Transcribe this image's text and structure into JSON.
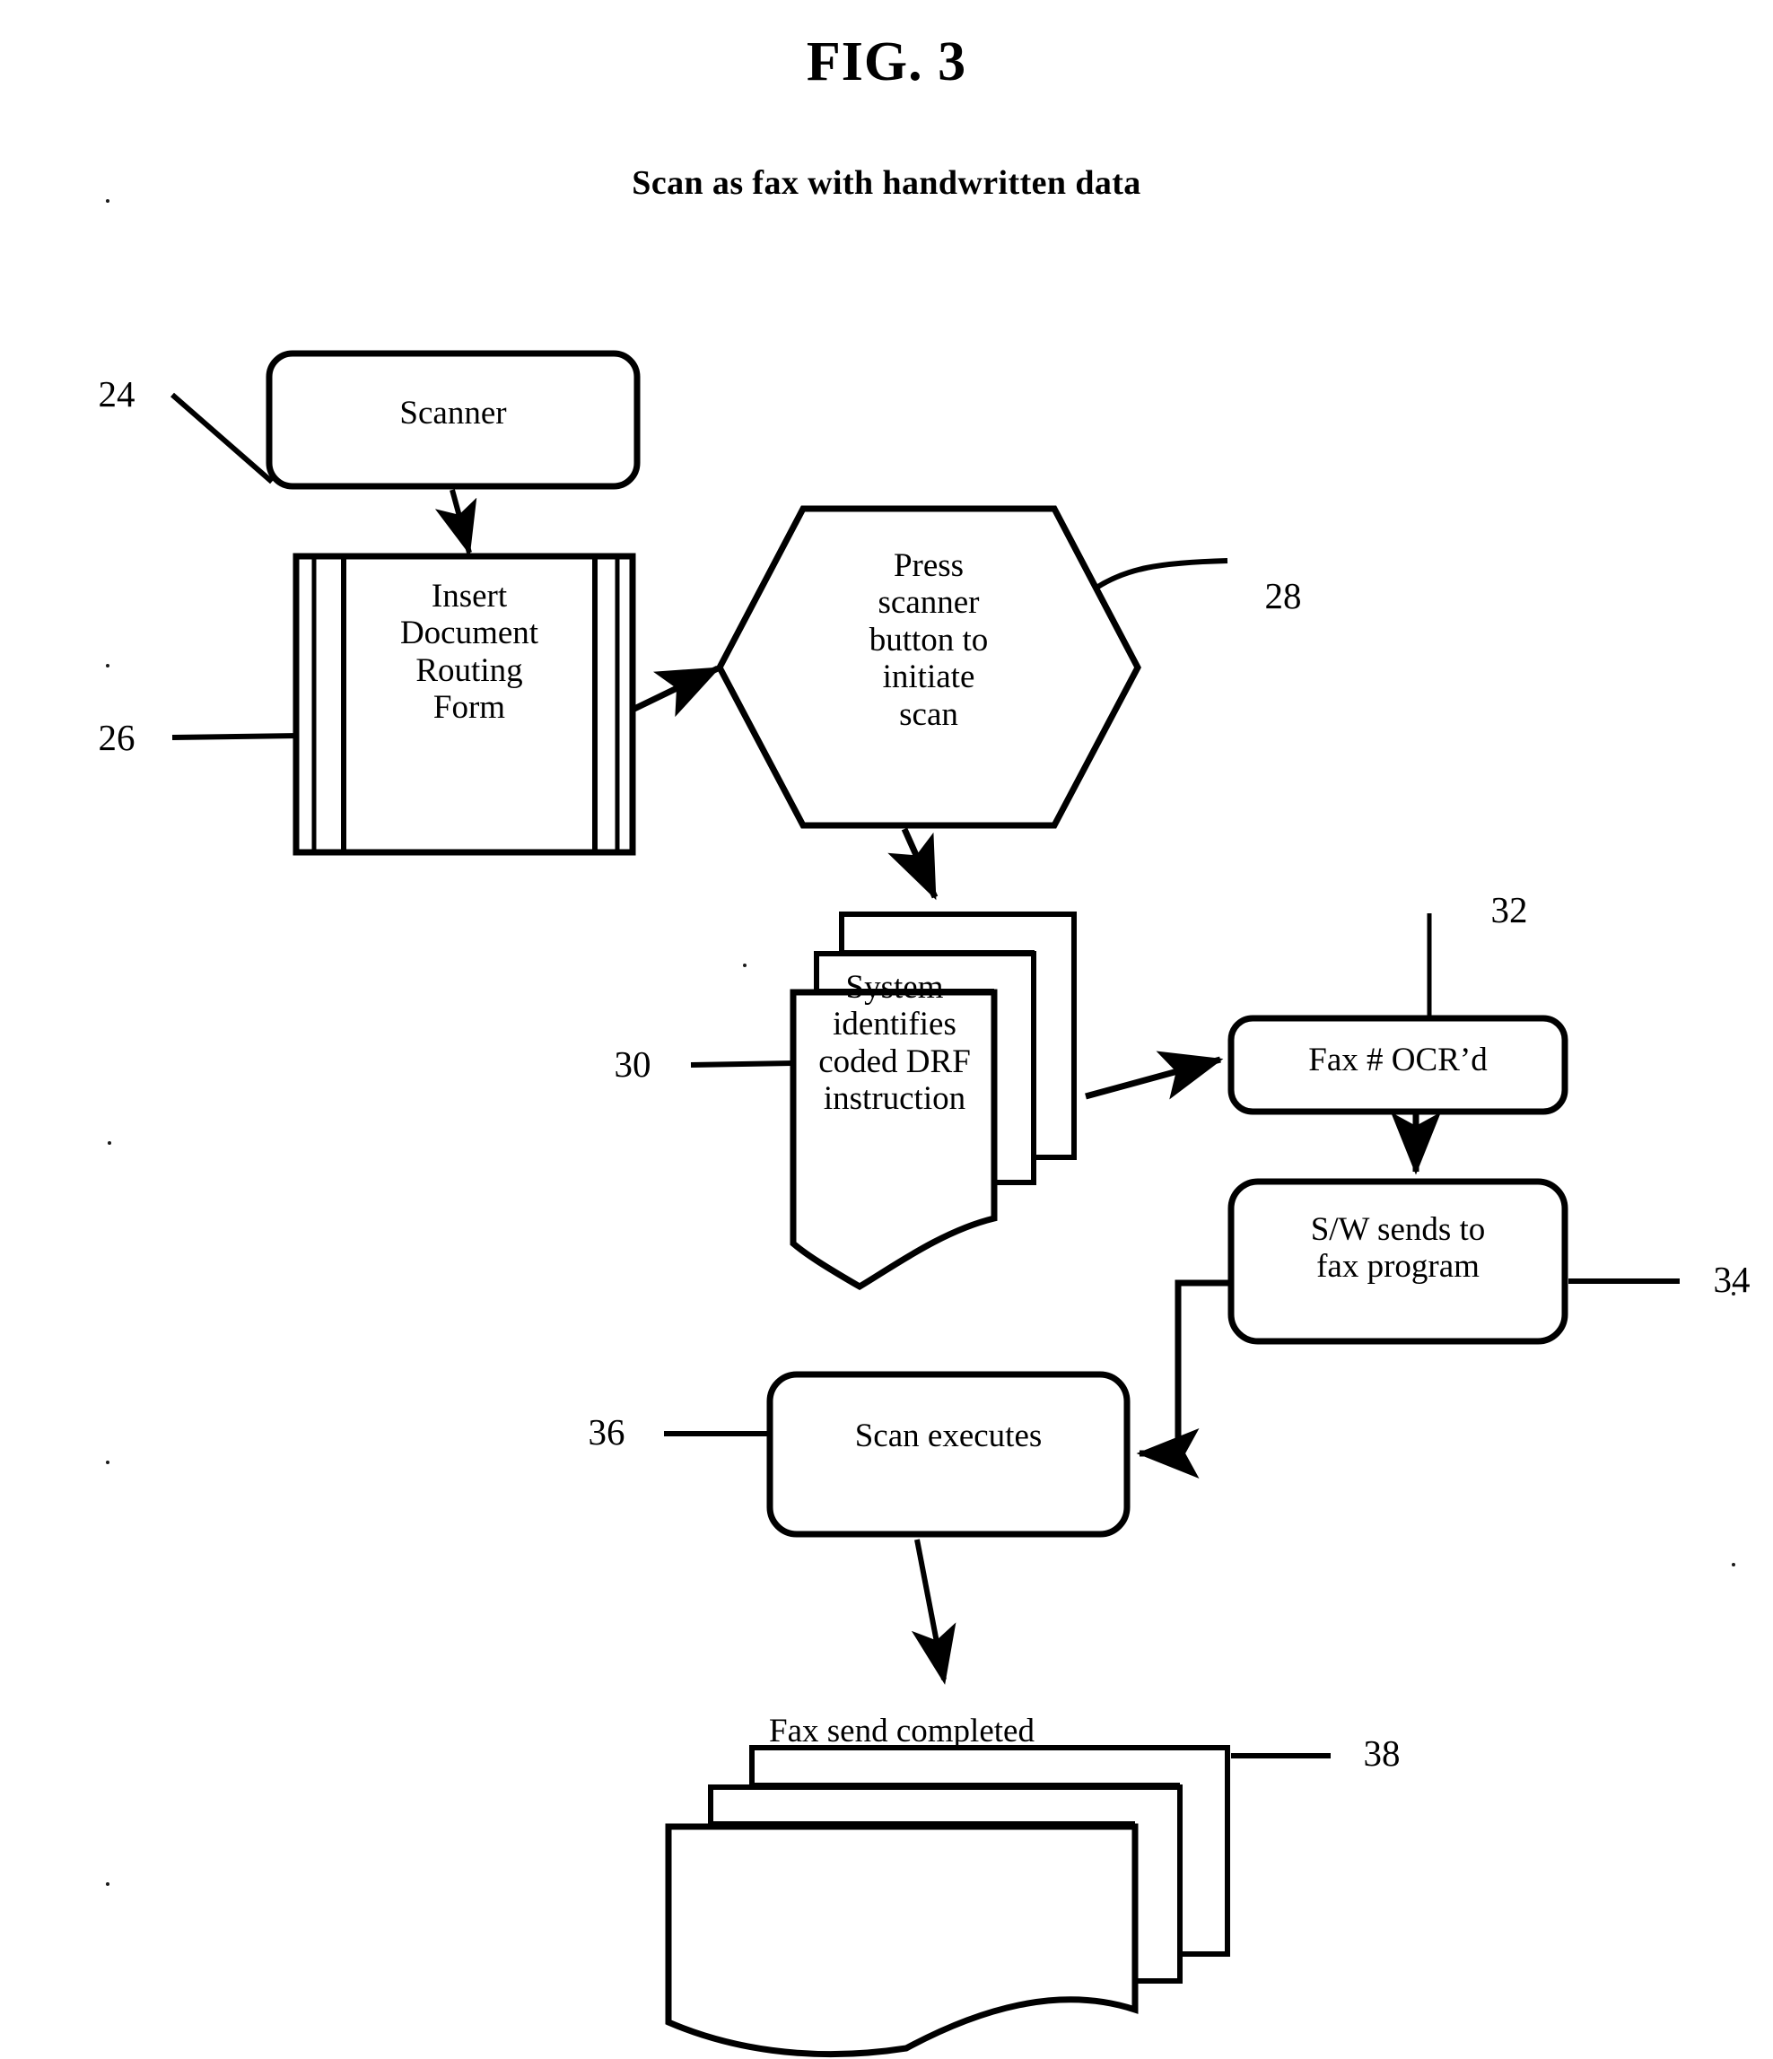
{
  "figure": {
    "title": "FIG. 3",
    "subtitle": "Scan as fax with handwritten data"
  },
  "nodes": {
    "scanner": {
      "label": "Scanner",
      "ref": "24",
      "shape": "rounded-rectangle"
    },
    "insert_drf": {
      "label": "Insert\nDocument\nRouting\nForm",
      "ref": "26",
      "shape": "document-with-margins"
    },
    "press_button": {
      "label": "Press\nscanner\nbutton to\ninitiate\nscan",
      "ref": "28",
      "shape": "hexagon"
    },
    "system_identifies": {
      "label": "System\nidentifies\ncoded DRF\ninstruction",
      "ref": "30",
      "shape": "multi-document"
    },
    "fax_ocr": {
      "label": "Fax # OCR’d",
      "ref": "32",
      "shape": "rounded-rectangle"
    },
    "sw_sends": {
      "label": "S/W sends to\nfax program",
      "ref": "34",
      "shape": "rounded-rectangle"
    },
    "scan_executes": {
      "label": "Scan executes",
      "ref": "36",
      "shape": "rounded-rectangle"
    },
    "fax_completed": {
      "label": "Fax send completed",
      "ref": "38",
      "shape": "multi-document"
    }
  },
  "reference_numerals": [
    {
      "id": "24",
      "value": "24",
      "target": "scanner"
    },
    {
      "id": "26",
      "value": "26",
      "target": "insert_drf"
    },
    {
      "id": "28",
      "value": "28",
      "target": "press_button"
    },
    {
      "id": "30",
      "value": "30",
      "target": "system_identifies"
    },
    {
      "id": "32",
      "value": "32",
      "target": "fax_ocr"
    },
    {
      "id": "34",
      "value": "34",
      "target": "sw_sends"
    },
    {
      "id": "36",
      "value": "36",
      "target": "scan_executes"
    },
    {
      "id": "38",
      "value": "38",
      "target": "fax_completed"
    }
  ],
  "flow_edges": [
    {
      "from": "scanner",
      "to": "insert_drf",
      "style": "arrow"
    },
    {
      "from": "insert_drf",
      "to": "press_button",
      "style": "arrow"
    },
    {
      "from": "press_button",
      "to": "system_identifies",
      "style": "arrow"
    },
    {
      "from": "system_identifies",
      "to": "fax_ocr",
      "style": "arrow"
    },
    {
      "from": "fax_ocr",
      "to": "sw_sends",
      "style": "arrow"
    },
    {
      "from": "sw_sends",
      "to": "scan_executes",
      "style": "elbow-arrow"
    },
    {
      "from": "scan_executes",
      "to": "fax_completed",
      "style": "arrow"
    }
  ],
  "colors": {
    "ink": "#000000",
    "paper": "#ffffff"
  }
}
